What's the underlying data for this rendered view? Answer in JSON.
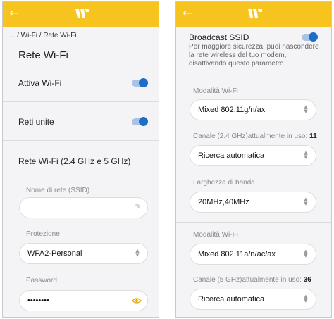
{
  "colors": {
    "brand_yellow": "#f7c31f",
    "toggle_blue": "#1f6dc9",
    "eye_gold": "#e3ac12"
  },
  "left": {
    "back_icon": "arrow-left-icon",
    "logo_icon": "windtre-logo-icon",
    "breadcrumb": "... / Wi-Fi / Rete Wi-Fi",
    "title": "Rete Wi-Fi",
    "toggles": [
      {
        "label": "Attiva Wi-Fi",
        "on": true
      },
      {
        "label": "Reti unite",
        "on": true
      }
    ],
    "network_section": "Rete Wi-Fi (2.4 GHz e 5 GHz)",
    "ssid": {
      "label": "Nome di rete (SSID)",
      "value": ""
    },
    "protection": {
      "label": "Protezione",
      "value": "WPA2-Personal"
    },
    "password": {
      "label": "Password",
      "value": "••••••••"
    }
  },
  "right": {
    "broadcast": {
      "label": "Broadcast SSID",
      "on": true,
      "description_lines": [
        "Per maggiore sicurezza, puoi nascondere",
        "la rete wireless del tuo modem,",
        "disattivando questo parametro"
      ]
    },
    "mode_24": {
      "label": "Modalità Wi-Fi",
      "value": "Mixed 802.11g/n/ax"
    },
    "channel_24": {
      "label": "Canale (2.4 GHz)attualmente in uso: ",
      "number": "11",
      "value": "Ricerca automatica"
    },
    "bandwidth": {
      "label": "Larghezza di banda",
      "value": "20MHz,40MHz"
    },
    "mode_5": {
      "label": "Modalità Wi-Fi",
      "value": "Mixed 802.11a/n/ac/ax"
    },
    "channel_5": {
      "label": "Canale (5 GHz)attualmente in uso: ",
      "number": "36",
      "value": "Ricerca automatica"
    }
  }
}
